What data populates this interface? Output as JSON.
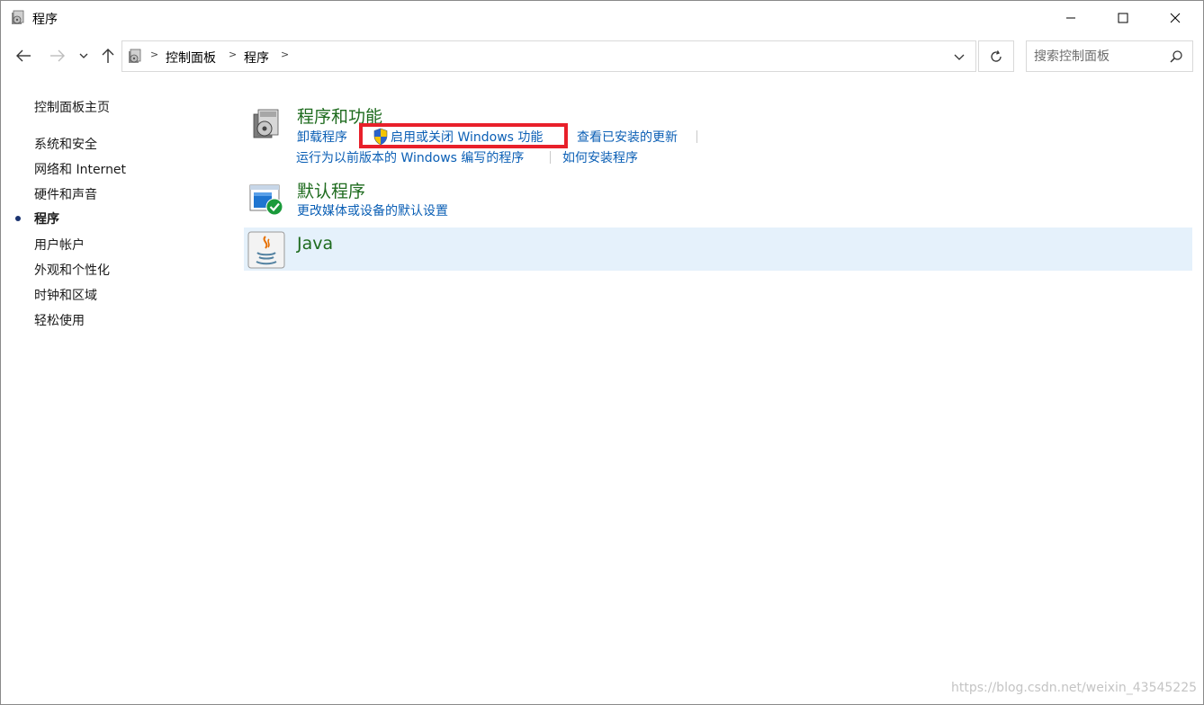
{
  "window": {
    "title": "程序",
    "minimize_icon": "minimize-icon",
    "maximize_icon": "maximize-icon",
    "close_icon": "close-icon"
  },
  "nav": {
    "breadcrumb": [
      "控制面板",
      "程序"
    ],
    "search_placeholder": "搜索控制面板"
  },
  "sidebar": {
    "items": [
      {
        "label": "控制面板主页",
        "active": false
      },
      {
        "label": "系统和安全",
        "active": false
      },
      {
        "label": "网络和 Internet",
        "active": false
      },
      {
        "label": "硬件和声音",
        "active": false
      },
      {
        "label": "程序",
        "active": true
      },
      {
        "label": "用户帐户",
        "active": false
      },
      {
        "label": "外观和个性化",
        "active": false
      },
      {
        "label": "时钟和区域",
        "active": false
      },
      {
        "label": "轻松使用",
        "active": false
      }
    ]
  },
  "categories": {
    "programs": {
      "title": "程序和功能",
      "links": [
        "卸载程序",
        "启用或关闭 Windows 功能",
        "查看已安装的更新",
        "运行为以前版本的 Windows 编写的程序",
        "如何安装程序"
      ]
    },
    "defaults": {
      "title": "默认程序",
      "links": [
        "更改媒体或设备的默认设置"
      ]
    },
    "java": {
      "title": "Java"
    }
  },
  "watermark": "https://blog.csdn.net/weixin_43545225",
  "colors": {
    "link": "#0b5fb5",
    "category_title": "#1e6b1e",
    "highlight": "#e8202a",
    "hover_row": "#e5f1fb"
  }
}
